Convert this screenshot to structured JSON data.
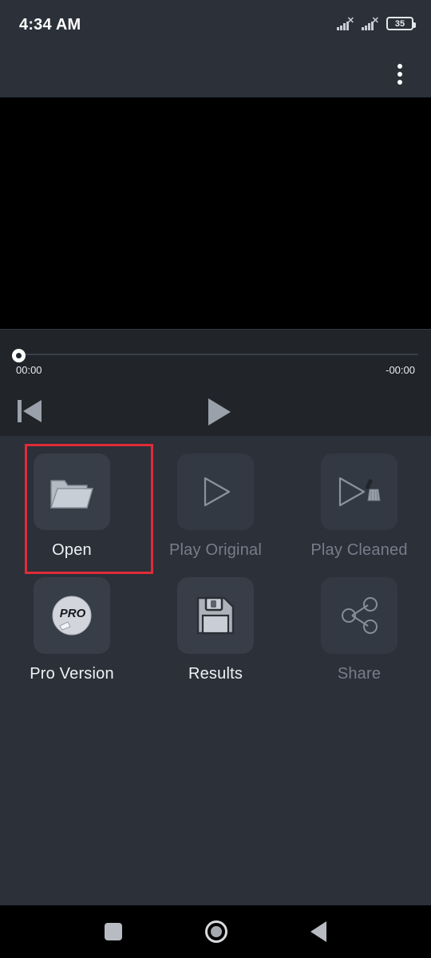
{
  "status_bar": {
    "time": "4:34 AM",
    "battery_level": "35",
    "signal_1": "signal-no-service-icon",
    "signal_2": "signal-no-service-icon",
    "battery_icon": "battery-icon"
  },
  "app_bar": {
    "overflow_icon": "overflow-menu-icon"
  },
  "video": {
    "surface": "video-surface-black"
  },
  "player": {
    "time_current": "00:00",
    "time_remaining": "-00:00",
    "seek_knob_icon": "seek-knob",
    "skip_start_icon": "skip-to-start-icon",
    "play_icon": "play-icon"
  },
  "actions": {
    "row1": [
      {
        "label": "Open",
        "icon": "folder-open-icon",
        "disabled": false,
        "highlighted": true
      },
      {
        "label": "Play Original",
        "icon": "play-outline-icon",
        "disabled": true,
        "highlighted": false
      },
      {
        "label": "Play Cleaned",
        "icon": "play-clean-icon",
        "disabled": true,
        "highlighted": false
      }
    ],
    "row2": [
      {
        "label": "Pro Version",
        "icon": "pro-badge-icon",
        "disabled": false,
        "highlighted": false
      },
      {
        "label": "Results",
        "icon": "floppy-save-icon",
        "disabled": false,
        "highlighted": false
      },
      {
        "label": "Share",
        "icon": "share-nodes-icon",
        "disabled": true,
        "highlighted": false
      }
    ]
  },
  "nav_bar": {
    "recent_icon": "recent-apps-icon",
    "home_icon": "home-icon",
    "back_icon": "back-icon"
  },
  "colors": {
    "background": "#2b3039",
    "player_panel": "#212529",
    "tile": "#383e48",
    "tile_disabled": "#333943",
    "highlight": "#e02b38",
    "text": "#f0f2f5",
    "text_disabled": "#767e8a"
  }
}
